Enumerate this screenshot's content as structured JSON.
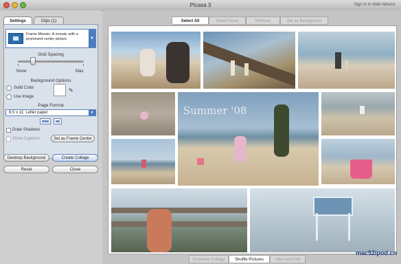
{
  "window": {
    "title": "Picasa 3",
    "signin": "Sign in to Web Albums"
  },
  "panel": {
    "tabs": [
      {
        "label": "Settings"
      },
      {
        "label": "Clips (1)"
      }
    ],
    "layout_select": {
      "text": "Frame Mosaic: A mosaic with a prominent center picture"
    },
    "grid_spacing": {
      "label": "Grid Spacing",
      "min_label": "None",
      "max_label": "Max.",
      "level": 0.2
    },
    "background": {
      "label": "Background Options",
      "solid_color": "Solid Color",
      "use_image": "Use Image",
      "swatch_color": "#ffffff"
    },
    "page_format": {
      "label": "Page Format",
      "value": "8.5 x 11:  Letter paper"
    },
    "draw_shadows": "Draw Shadows",
    "show_captions": "Show Captions",
    "set_frame_center": "Set as Frame Center",
    "buttons": {
      "desktop_background": "Desktop Background",
      "create_collage": "Create Collage",
      "reset": "Reset",
      "close": "Close"
    }
  },
  "toolbar": {
    "select_all": "Select All",
    "select_none": "Select None",
    "remove": "Remove",
    "set_background": "Set as Background"
  },
  "collage": {
    "caption": "Summer '08"
  },
  "bottom": {
    "scramble": "Scramble Collage",
    "shuffle": "Shuffle Pictures",
    "view_edit": "View and Edit"
  },
  "watermark": "mac52ipod.cn",
  "colors": {
    "accent": "#4d7cc2",
    "panel_bg": "#d9e1ea",
    "canvas_bg": "#ffffff"
  }
}
